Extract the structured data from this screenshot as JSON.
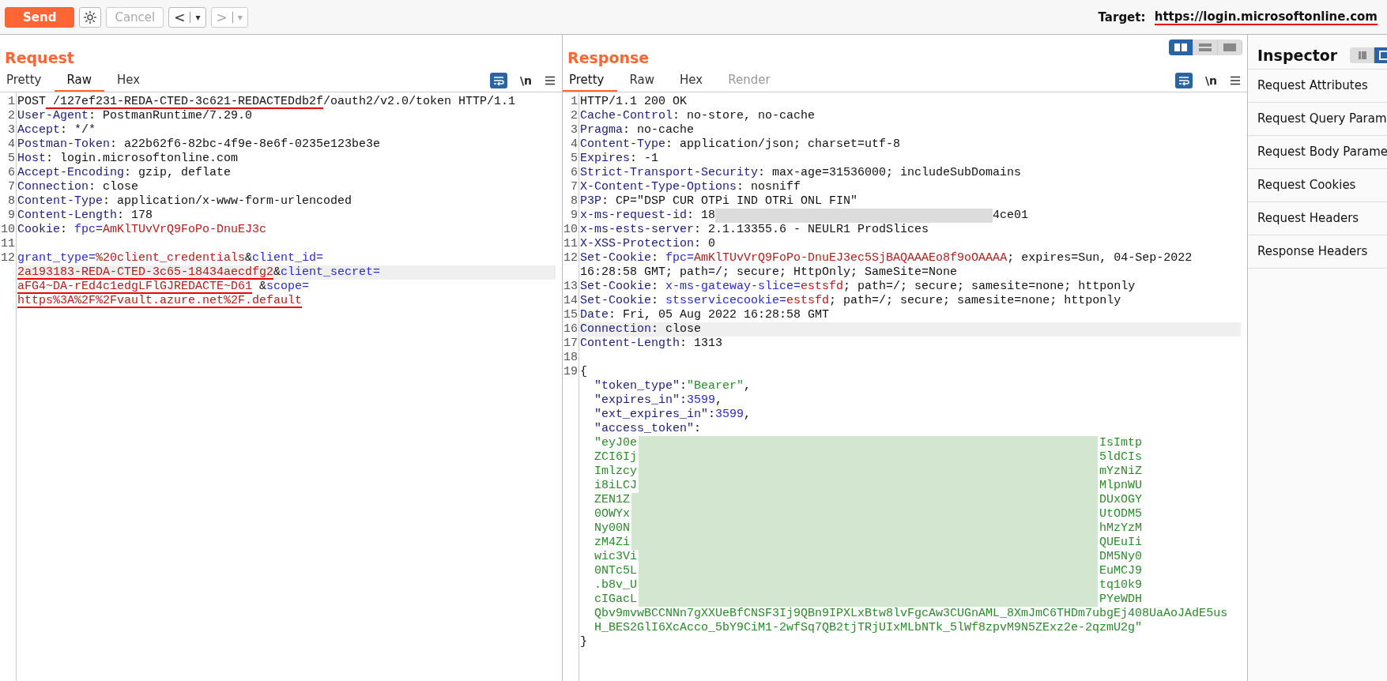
{
  "toolbar": {
    "send": "Send",
    "cancel": {
      "label": "Cancel",
      "disabled": true
    },
    "back": {
      "label": "<",
      "menu": "▾",
      "disabled": false
    },
    "forward": {
      "label": ">",
      "menu": "▾",
      "disabled": true
    },
    "target_label": "Target:",
    "target_url": "https://login.microsoftonline.com",
    "target_marked": true
  },
  "request": {
    "title": "Request",
    "tabs": [
      {
        "label": "Pretty",
        "selected": false,
        "disabled": false
      },
      {
        "label": "Raw",
        "selected": true,
        "disabled": false
      },
      {
        "label": "Hex",
        "selected": false,
        "disabled": false
      }
    ],
    "newline_toggle": "\\n",
    "lines": [
      {
        "number": "1",
        "segments": [
          {
            "kind": "plain",
            "text": "POST"
          },
          {
            "kind": "plain",
            "text": " /127ef231-REDA-CTED-3c621-REDACTEDdb2f",
            "marked": true
          },
          {
            "kind": "plain",
            "text": "/oauth2/v2.0/token HTTP/1.1"
          }
        ]
      },
      {
        "number": "2",
        "segments": [
          {
            "kind": "header",
            "text": "User-Agent"
          },
          {
            "kind": "plain",
            "text": ": PostmanRuntime/7.29.0"
          }
        ]
      },
      {
        "number": "3",
        "segments": [
          {
            "kind": "header",
            "text": "Accept"
          },
          {
            "kind": "plain",
            "text": ": */*"
          }
        ]
      },
      {
        "number": "4",
        "segments": [
          {
            "kind": "header",
            "text": "Postman-Token"
          },
          {
            "kind": "plain",
            "text": ": a22b62f6-82bc-4f9e-8e6f-0235e123be3e"
          }
        ]
      },
      {
        "number": "5",
        "segments": [
          {
            "kind": "header",
            "text": "Host"
          },
          {
            "kind": "plain",
            "text": ": login.microsoftonline.com"
          }
        ]
      },
      {
        "number": "6",
        "segments": [
          {
            "kind": "header",
            "text": "Accept-Encoding"
          },
          {
            "kind": "plain",
            "text": ": gzip, deflate"
          }
        ]
      },
      {
        "number": "7",
        "segments": [
          {
            "kind": "header",
            "text": "Connection"
          },
          {
            "kind": "plain",
            "text": ": close"
          }
        ]
      },
      {
        "number": "8",
        "segments": [
          {
            "kind": "header",
            "text": "Content-Type"
          },
          {
            "kind": "plain",
            "text": ": application/x-www-form-urlencoded"
          }
        ]
      },
      {
        "number": "9",
        "segments": [
          {
            "kind": "header",
            "text": "Content-Length"
          },
          {
            "kind": "plain",
            "text": ": 178"
          }
        ]
      },
      {
        "number": "10",
        "segments": [
          {
            "kind": "header",
            "text": "Cookie"
          },
          {
            "kind": "plain",
            "text": ": "
          },
          {
            "kind": "param",
            "text": "fpc"
          },
          {
            "kind": "param",
            "text": "="
          },
          {
            "kind": "value",
            "text": "AmKlTUvVrQ9FoPo-DnuEJ3c"
          }
        ]
      },
      {
        "number": "11"
      },
      {
        "number": "12",
        "rows": [
          {
            "segments": [
              {
                "kind": "param",
                "text": "grant_type"
              },
              {
                "kind": "param",
                "text": "="
              },
              {
                "kind": "value",
                "text": "%20client_credentials"
              },
              {
                "kind": "plain",
                "text": "&"
              },
              {
                "kind": "param",
                "text": "client_id"
              },
              {
                "kind": "param",
                "text": "="
              }
            ]
          },
          {
            "highlighted": true,
            "segments": [
              {
                "kind": "value",
                "text": "2a193183-REDA-CTED-3c65-18434aecdfg2",
                "marked": true
              },
              {
                "kind": "plain",
                "text": "&"
              },
              {
                "kind": "param",
                "text": "client_secret"
              },
              {
                "kind": "param",
                "text": "="
              }
            ]
          },
          {
            "segments": [
              {
                "kind": "value",
                "text": "aFG4~DA-rEd4c1edgLFlGJREDACTE~D61",
                "marked": true
              },
              {
                "kind": "plain",
                "text": " &"
              },
              {
                "kind": "param",
                "text": "scope"
              },
              {
                "kind": "param",
                "text": "="
              }
            ]
          },
          {
            "segments": [
              {
                "kind": "value",
                "text": "https%3A%2F%2Fvault.azure.net%2F.default",
                "marked": true
              }
            ]
          }
        ]
      }
    ]
  },
  "response": {
    "title": "Response",
    "layout_options": [
      {
        "kind": "columns",
        "selected": true
      },
      {
        "kind": "rows",
        "selected": false
      },
      {
        "kind": "single",
        "selected": false
      }
    ],
    "tabs": [
      {
        "label": "Pretty",
        "selected": true,
        "disabled": false
      },
      {
        "label": "Raw",
        "selected": false,
        "disabled": false
      },
      {
        "label": "Hex",
        "selected": false,
        "disabled": false
      },
      {
        "label": "Render",
        "selected": false,
        "disabled": true
      }
    ],
    "newline_toggle": "\\n",
    "lines": [
      {
        "number": "1",
        "segments": [
          {
            "kind": "plain",
            "text": "HTTP/1.1 200 OK"
          }
        ]
      },
      {
        "number": "2",
        "segments": [
          {
            "kind": "header",
            "text": "Cache-Control"
          },
          {
            "kind": "plain",
            "text": ": no-store, no-cache"
          }
        ]
      },
      {
        "number": "3",
        "segments": [
          {
            "kind": "header",
            "text": "Pragma"
          },
          {
            "kind": "plain",
            "text": ": no-cache"
          }
        ]
      },
      {
        "number": "4",
        "segments": [
          {
            "kind": "header",
            "text": "Content-Type"
          },
          {
            "kind": "plain",
            "text": ": application/json; charset=utf-8"
          }
        ]
      },
      {
        "number": "5",
        "segments": [
          {
            "kind": "header",
            "text": "Expires"
          },
          {
            "kind": "plain",
            "text": ": -1"
          }
        ]
      },
      {
        "number": "6",
        "segments": [
          {
            "kind": "header",
            "text": "Strict-Transport-Security"
          },
          {
            "kind": "plain",
            "text": ": max-age=31536000; includeSubDomains"
          }
        ]
      },
      {
        "number": "7",
        "segments": [
          {
            "kind": "header",
            "text": "X-Content-Type-Options"
          },
          {
            "kind": "plain",
            "text": ": nosniff"
          }
        ]
      },
      {
        "number": "8",
        "segments": [
          {
            "kind": "header",
            "text": "P3P"
          },
          {
            "kind": "plain",
            "text": ": CP=\"DSP CUR OTPi IND OTRi ONL FIN\""
          }
        ]
      },
      {
        "number": "9",
        "segments": [
          {
            "kind": "header",
            "text": "x-ms-request-id"
          },
          {
            "kind": "plain",
            "text": ": 18"
          },
          {
            "kind": "blur-short"
          },
          {
            "kind": "plain",
            "text": "4ce01"
          }
        ]
      },
      {
        "number": "10",
        "segments": [
          {
            "kind": "header",
            "text": "x-ms-ests-server"
          },
          {
            "kind": "plain",
            "text": ": 2.1.13355.6 - NEULR1 ProdSlices"
          }
        ]
      },
      {
        "number": "11",
        "segments": [
          {
            "kind": "header",
            "text": "X-XSS-Protection"
          },
          {
            "kind": "plain",
            "text": ": 0"
          }
        ]
      },
      {
        "number": "12",
        "rows": [
          {
            "segments": [
              {
                "kind": "header",
                "text": "Set-Cookie"
              },
              {
                "kind": "plain",
                "text": ": "
              },
              {
                "kind": "param",
                "text": "fpc"
              },
              {
                "kind": "param",
                "text": "="
              },
              {
                "kind": "value",
                "text": "AmKlTUvVrQ9FoPo-DnuEJ3ec5SjBAQAAAEo8f9oOAAAA"
              },
              {
                "kind": "plain",
                "text": "; expires=Sun, 04-Sep-2022"
              }
            ]
          },
          {
            "segments": [
              {
                "kind": "plain",
                "text": "16:28:58 GMT; path=/; secure; HttpOnly; SameSite=None"
              }
            ]
          }
        ]
      },
      {
        "number": "13",
        "segments": [
          {
            "kind": "header",
            "text": "Set-Cookie"
          },
          {
            "kind": "plain",
            "text": ": "
          },
          {
            "kind": "param",
            "text": "x-ms-gateway-slice"
          },
          {
            "kind": "param",
            "text": "="
          },
          {
            "kind": "value",
            "text": "estsfd"
          },
          {
            "kind": "plain",
            "text": "; path=/; secure; samesite=none; httponly"
          }
        ]
      },
      {
        "number": "14",
        "segments": [
          {
            "kind": "header",
            "text": "Set-Cookie"
          },
          {
            "kind": "plain",
            "text": ": "
          },
          {
            "kind": "param",
            "text": "stsservicecookie"
          },
          {
            "kind": "param",
            "text": "="
          },
          {
            "kind": "value",
            "text": "estsfd"
          },
          {
            "kind": "plain",
            "text": "; path=/; secure; samesite=none; httponly"
          }
        ]
      },
      {
        "number": "15",
        "segments": [
          {
            "kind": "header",
            "text": "Date"
          },
          {
            "kind": "plain",
            "text": ": Fri, 05 Aug 2022 16:28:58 GMT"
          }
        ]
      },
      {
        "number": "16",
        "highlighted": true,
        "segments": [
          {
            "kind": "header",
            "text": "Connection"
          },
          {
            "kind": "plain",
            "text": ": close"
          }
        ]
      },
      {
        "number": "17",
        "segments": [
          {
            "kind": "header",
            "text": "Content-Length"
          },
          {
            "kind": "plain",
            "text": ": 1313"
          }
        ]
      },
      {
        "number": "18"
      },
      {
        "number": "19",
        "rows": [
          {
            "segments": [
              {
                "kind": "plain",
                "text": "{"
              }
            ]
          },
          {
            "indented": true,
            "segments": [
              {
                "kind": "key",
                "text": "\"token_type\""
              },
              {
                "kind": "plain",
                "text": ":"
              },
              {
                "kind": "string",
                "text": "\"Bearer\""
              },
              {
                "kind": "plain",
                "text": ","
              }
            ]
          },
          {
            "indented": true,
            "segments": [
              {
                "kind": "key",
                "text": "\"expires_in\""
              },
              {
                "kind": "plain",
                "text": ":"
              },
              {
                "kind": "number",
                "text": "3599"
              },
              {
                "kind": "plain",
                "text": ","
              }
            ]
          },
          {
            "indented": true,
            "segments": [
              {
                "kind": "key",
                "text": "\"ext_expires_in\""
              },
              {
                "kind": "plain",
                "text": ":"
              },
              {
                "kind": "number",
                "text": "3599"
              },
              {
                "kind": "plain",
                "text": ","
              }
            ]
          },
          {
            "indented": true,
            "segments": [
              {
                "kind": "key",
                "text": "\"access_token\""
              },
              {
                "kind": "plain",
                "text": ":"
              }
            ]
          },
          {
            "indented": true,
            "segments": [
              {
                "kind": "string",
                "text": "\"eyJ0e"
              },
              {
                "kind": "blur-wide"
              },
              {
                "kind": "string",
                "text": "IsImtp"
              }
            ]
          },
          {
            "indented": true,
            "segments": [
              {
                "kind": "string",
                "text": "ZCI6Ij"
              },
              {
                "kind": "blur-wide"
              },
              {
                "kind": "string",
                "text": "5ldCIs"
              }
            ]
          },
          {
            "indented": true,
            "segments": [
              {
                "kind": "string",
                "text": "Imlzcy"
              },
              {
                "kind": "blur-wide"
              },
              {
                "kind": "string",
                "text": "mYzNiZ"
              }
            ]
          },
          {
            "indented": true,
            "segments": [
              {
                "kind": "string",
                "text": "i8iLCJ"
              },
              {
                "kind": "blur-wide"
              },
              {
                "kind": "string",
                "text": "MlpnWU"
              }
            ]
          },
          {
            "indented": true,
            "segments": [
              {
                "kind": "string",
                "text": "ZEN1Z"
              },
              {
                "kind": "blur-wide"
              },
              {
                "kind": "string",
                "text": "DUxOGY"
              }
            ]
          },
          {
            "indented": true,
            "segments": [
              {
                "kind": "string",
                "text": "0OWYx"
              },
              {
                "kind": "blur-wide"
              },
              {
                "kind": "string",
                "text": "UtODM5"
              }
            ]
          },
          {
            "indented": true,
            "segments": [
              {
                "kind": "string",
                "text": "Ny00N"
              },
              {
                "kind": "blur-wide"
              },
              {
                "kind": "string",
                "text": "hMzYzM"
              }
            ]
          },
          {
            "indented": true,
            "segments": [
              {
                "kind": "string",
                "text": "zM4Zi"
              },
              {
                "kind": "blur-wide"
              },
              {
                "kind": "string",
                "text": "QUEuIi"
              }
            ]
          },
          {
            "indented": true,
            "segments": [
              {
                "kind": "string",
                "text": "wic3Vi"
              },
              {
                "kind": "blur-wide"
              },
              {
                "kind": "string",
                "text": "DM5Ny0"
              }
            ]
          },
          {
            "indented": true,
            "segments": [
              {
                "kind": "string",
                "text": "0NTc5L"
              },
              {
                "kind": "blur-wide"
              },
              {
                "kind": "string",
                "text": "EuMCJ9"
              }
            ]
          },
          {
            "indented": true,
            "segments": [
              {
                "kind": "string",
                "text": ".b8v_U"
              },
              {
                "kind": "blur-wide"
              },
              {
                "kind": "string",
                "text": "tq10k9"
              }
            ]
          },
          {
            "indented": true,
            "segments": [
              {
                "kind": "string",
                "text": "cIGacL"
              },
              {
                "kind": "blur-wide"
              },
              {
                "kind": "string",
                "text": "PYeWDH"
              }
            ]
          },
          {
            "indented": true,
            "segments": [
              {
                "kind": "string",
                "text": "Qbv9mvwBCCNNn7gXXUeBfCNSF3Ij9QBn9IPXLxBtw8lvFgcAw3CUGnAML_8XmJmC6THDm7ubgEj408UaAoJAdE5us"
              }
            ]
          },
          {
            "indented": true,
            "segments": [
              {
                "kind": "string",
                "text": "H_BES2GlI6XcAcco_5bY9CiM1-2wfSq7QB2tjTRjUIxMLbNTk_5lWf8zpvM9N5ZExz2e-2qzmU2g\""
              }
            ]
          },
          {
            "segments": [
              {
                "kind": "plain",
                "text": "}"
              }
            ]
          }
        ]
      }
    ]
  },
  "inspector": {
    "title": "Inspector",
    "layout_options": [
      {
        "kind": "side",
        "selected": false
      },
      {
        "kind": "panel",
        "selected": true
      }
    ],
    "items": [
      "Request Attributes",
      "Request Query Param",
      "Request Body Parame",
      "Request Cookies",
      "Request Headers",
      "Response Headers"
    ]
  }
}
